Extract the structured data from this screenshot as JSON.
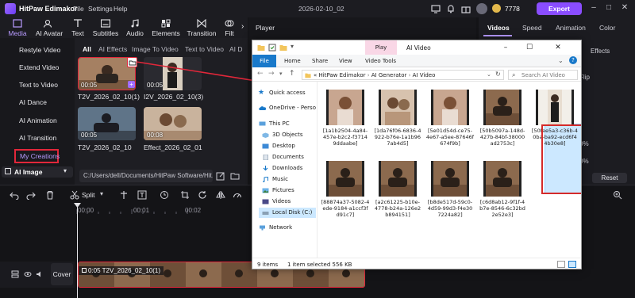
{
  "titlebar": {
    "app_name": "HitPaw Edimakor",
    "menu": [
      "File",
      "Settings",
      "Help"
    ],
    "project_name": "2026-02-10_02",
    "coins": "7778",
    "export_label": "Export"
  },
  "toolbar": {
    "tools": [
      "Media",
      "AI Avatar",
      "Text",
      "Subtitles",
      "Audio",
      "Elements",
      "Transition",
      "Filt"
    ],
    "active": "Media"
  },
  "leftnav": {
    "items": [
      "Restyle Video",
      "Extend Video",
      "Text to Video",
      "AI Dance",
      "AI Animation",
      "AI Transition",
      "My Creations"
    ],
    "categories": [
      "AI Image"
    ]
  },
  "media": {
    "subtabs": [
      "All",
      "AI Effects",
      "Image To Video",
      "Text to Video",
      "AI D"
    ],
    "active_subtab": "All",
    "items": [
      {
        "duration": "00:05",
        "name": "T2V_2026_02_10(1)"
      },
      {
        "duration": "00:05",
        "name": "I2V_2026_02_10(3)"
      },
      {
        "duration": "00:05",
        "name": "T2V_2026_02_10"
      },
      {
        "duration": "00:08",
        "name": "Effect_2026_02_01"
      }
    ],
    "path": "C:/Users/dell/Documents/HitPaw Software/Hit..."
  },
  "player": {
    "title": "Player"
  },
  "rightpanel": {
    "tabs": [
      "Videos",
      "Speed",
      "Animation",
      "Color"
    ],
    "active_tab": "Videos",
    "effects_label": "Effects",
    "flip_label": "Flip",
    "reset_label": "Reset",
    "pct1": "0%",
    "pct2": "0%"
  },
  "timeline": {
    "split_label": "Split",
    "ruler": [
      "00:00",
      "00:01",
      "00:02"
    ],
    "clip_label": "0:05 T2V_2026_02_10(1)",
    "cover_label": "Cover"
  },
  "explorer": {
    "play_tab": "Play",
    "window_title": "AI Video",
    "ribbon": [
      "File",
      "Home",
      "Share",
      "View",
      "Video Tools"
    ],
    "breadcrumb": [
      "HitPaw Edimakor",
      "AI Generator",
      "AI Video"
    ],
    "breadcrumb_prefix": "«",
    "search_placeholder": "Search AI Video",
    "nav": [
      "Quick access",
      "OneDrive - Perso",
      "This PC",
      "3D Objects",
      "Desktop",
      "Documents",
      "Downloads",
      "Music",
      "Pictures",
      "Videos",
      "Local Disk (C:)",
      "Network"
    ],
    "files": [
      {
        "name": "[1a1b2504-4a84-457e-b2c2-f3714 9ddaabe]",
        "scene": "woman"
      },
      {
        "name": "[1da76f06-6836-4 922-b76e-1a1b96 7ab4d5]",
        "scene": "couple"
      },
      {
        "name": "[5e01d54d-ce75-4e67-a5ee-87646f 674f9b]",
        "scene": "woman"
      },
      {
        "name": "[50b5097a-148d-427b-84bf-38000 ad2753c]",
        "scene": "moto",
        "selected": true
      },
      {
        "name": "[50fee5a3-c36b-4 0ba-ba92-ecd6f4 4b30e8]",
        "scene": "man"
      },
      {
        "name": "[88874a37-5082-4 ede-9184-a1ccf3f d91c7]",
        "scene": "moto"
      },
      {
        "name": "[a2c61225-b10e-4778-b24a-126e2 b894151]",
        "scene": "moto"
      },
      {
        "name": "[b8de517d-59c0-4d59-99d3-f4e30 7224a82]",
        "scene": "moto"
      },
      {
        "name": "[c6d8ab12-9f1f-4 b7e-8546-6c32bd 2e52e3]",
        "scene": "moto"
      }
    ],
    "status_count": "9 items",
    "status_selected": "1 item selected  556 KB"
  },
  "colors": {
    "accent": "#8a4dff",
    "highlight_red": "#e2273a",
    "windows_blue": "#1979ca"
  }
}
